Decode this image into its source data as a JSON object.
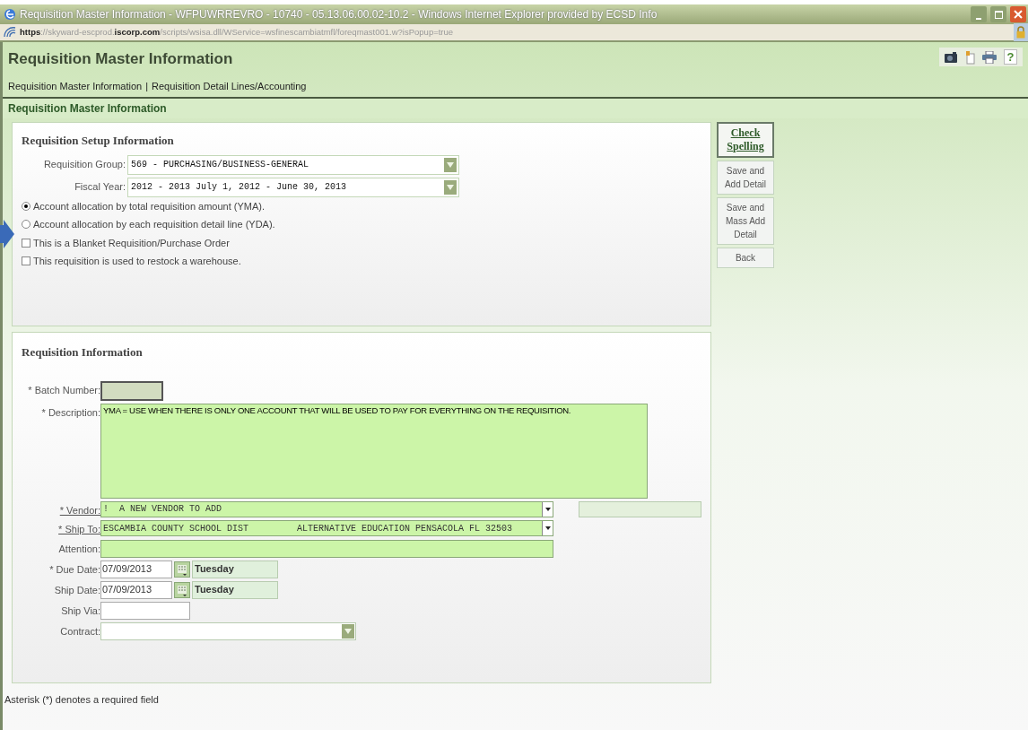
{
  "window": {
    "title": "Requisition Master Information - WFPUWRREVRO - 10740 - 05.13.06.00.02-10.2 - Windows Internet Explorer provided by ECSD Info",
    "url": "**https**://skyward-escprod.**iscorp.com**/scripts/wsisa.dll/WService=wsfinescambiatmfl/foreqmast001.w?isPopup=true"
  },
  "page_title": "Requisition Master Information",
  "help_label": "?",
  "nav_links": [
    {
      "label": "Requisition Master Information"
    },
    {
      "label": "Requisition Detail Lines/Accounting"
    }
  ],
  "nav_separator": "|",
  "section_heading": "Requisition Master Information",
  "setup": {
    "title": "Requisition Setup Information",
    "fields": [
      {
        "label": "Requisition Group:",
        "value": "569 - PURCHASING/BUSINESS-GENERAL"
      },
      {
        "label": "Fiscal Year:",
        "value": "2012 - 2013 July 1, 2012 - June 30, 2013"
      }
    ],
    "options": [
      {
        "kind": "radio",
        "label": "Account allocation by total requisition amount (YMA).",
        "checked": true
      },
      {
        "kind": "radio",
        "label": "Account allocation by each requisition detail line (YDA).",
        "checked": false
      },
      {
        "kind": "checkbox",
        "label": "This is a Blanket Requisition/Purchase Order",
        "checked": false
      },
      {
        "kind": "checkbox",
        "label": "This requisition is used to restock a warehouse.",
        "checked": false
      }
    ]
  },
  "side_buttons": [
    {
      "label": "Check Spelling",
      "default": true
    },
    {
      "label": "Save and Add Detail",
      "default": false
    },
    {
      "label": "Save and Mass Add Detail",
      "default": false
    },
    {
      "label": "Back",
      "default": false
    }
  ],
  "requisition": {
    "title": "Requisition Information",
    "fields": [
      {
        "kind": "batch",
        "label": "* Batch Number:",
        "link": false
      },
      {
        "kind": "textarea",
        "label": "* Description:",
        "value": "YMA = USE WHEN THERE IS ONLY ONE ACCOUNT THAT WILL BE USED TO PAY FOR EVERYTHING ON THE REQUISITION.",
        "link": false
      },
      {
        "kind": "combo",
        "label": "* Vendor:",
        "value": "!  A NEW VENDOR TO ADD",
        "link": true,
        "extra_field": true
      },
      {
        "kind": "combo",
        "label": "* Ship To:",
        "value": "ESCAMBIA COUNTY SCHOOL DIST         ALTERNATIVE EDUCATION PENSACOLA FL 32503",
        "link": true,
        "extra_field": false
      },
      {
        "kind": "text",
        "label": "Attention:",
        "link": false
      },
      {
        "kind": "date",
        "label": "* Due Date:",
        "value": "07/09/2013",
        "day": "Tuesday",
        "link": false
      },
      {
        "kind": "date",
        "label": "Ship Date:",
        "value": "07/09/2013",
        "day": "Tuesday",
        "link": false
      },
      {
        "kind": "plain",
        "label": "Ship Via:",
        "link": false
      },
      {
        "kind": "select",
        "label": "Contract:",
        "link": false
      }
    ]
  },
  "footnote": "Asterisk (*) denotes a required field"
}
